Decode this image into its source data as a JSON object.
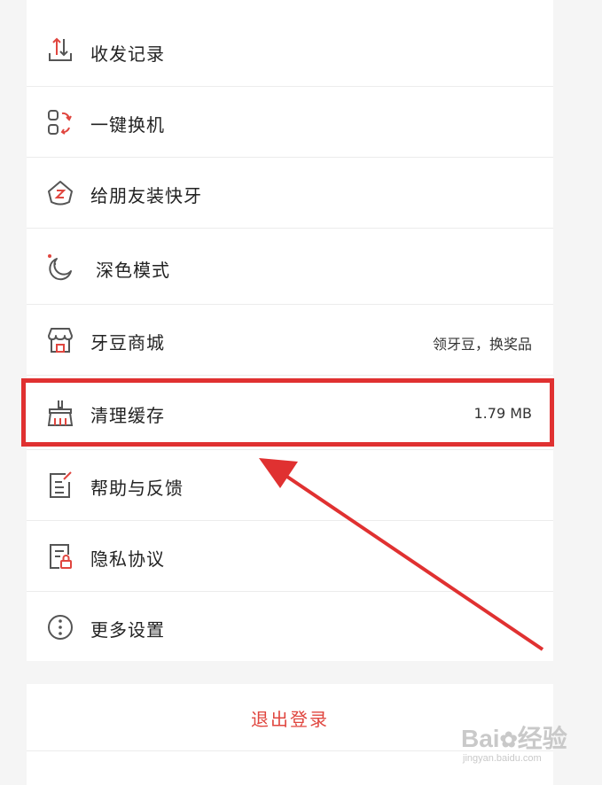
{
  "menu": {
    "items": [
      {
        "label": "收发记录",
        "icon": "send-receive-arrows-icon"
      },
      {
        "label": "一键换机",
        "icon": "phone-transfer-icon"
      },
      {
        "label": "给朋友装快牙",
        "icon": "house-share-icon"
      },
      {
        "label": "深色模式",
        "icon": "moon-icon"
      },
      {
        "label": "牙豆商城",
        "icon": "store-icon",
        "value": "领牙豆，换奖品"
      },
      {
        "label": "清理缓存",
        "icon": "broom-icon",
        "value": "1.79 MB"
      },
      {
        "label": "帮助与反馈",
        "icon": "feedback-doc-icon"
      },
      {
        "label": "隐私协议",
        "icon": "privacy-doc-lock-icon"
      },
      {
        "label": "更多设置",
        "icon": "more-options-icon"
      }
    ]
  },
  "logout": {
    "label": "退出登录"
  },
  "annotation": {
    "highlight_color": "#e03131"
  },
  "colors": {
    "accent": "#e0463f",
    "icon_stroke": "#555555"
  }
}
